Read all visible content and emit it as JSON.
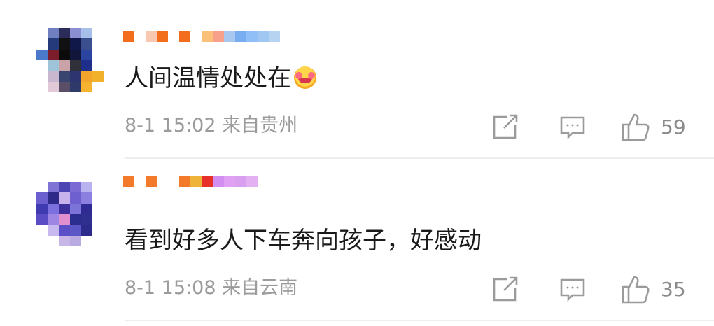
{
  "comments": [
    {
      "text": "人间温情处处在",
      "time": "8-1 15:02",
      "location": "来自贵州",
      "likes": "59",
      "avatar_colors": [
        "#ffffff",
        "#6f7fbf",
        "#2b2c5a",
        "#8b8fd1",
        "#a7c0ea",
        "#ffffff",
        "#ffffff",
        "#243a7a",
        "#111111",
        "#10184a",
        "#3b4f8f",
        "#ffffff",
        "#4b79ca",
        "#7b1d2a",
        "#0b0b0b",
        "#12163a",
        "#2a44a0",
        "#ffffff",
        "#ffffff",
        "#9fc4d9",
        "#c9a3a8",
        "#30303a",
        "#1d2f8a",
        "#ffffff",
        "#ffffff",
        "#c9b7cf",
        "#39456e",
        "#2d3470",
        "#f2a42b",
        "#f1b12a",
        "#ffffff",
        "#e2c9d8",
        "#5b4e68",
        "#303a6a",
        "#f7b32f",
        "#ffffff"
      ],
      "username_colors": [
        "#f26d1c",
        "#ffffff",
        "#f8c8b0",
        "#f26d1c",
        "#ffffff",
        "#f26d1c",
        "#ffffff",
        "#fbc07a",
        "#f7a08a",
        "#a8c8f0",
        "#78aef0",
        "#8fbff6",
        "#9fc7f2",
        "#b6d4f2"
      ]
    },
    {
      "text": "看到好多人下车奔向孩子，好感动",
      "time": "8-1 15:08",
      "location": "来自云南",
      "likes": "35",
      "avatar_colors": [
        "#ffffff",
        "#7f74d6",
        "#4c44b2",
        "#7b6ad4",
        "#b8b2ee",
        "#ffffff",
        "#6b5fd0",
        "#2d2a8a",
        "#c7b2ec",
        "#6f60cf",
        "#8b7fe0",
        "#ffffff",
        "#3f3ab0",
        "#7b70de",
        "#3c2f9b",
        "#7c74d8",
        "#2f2b92",
        "#ffffff",
        "#5a4cc4",
        "#9d86e4",
        "#e090cf",
        "#2b2d8f",
        "#2f2f8f",
        "#ffffff",
        "#ffffff",
        "#c8b8f0",
        "#5a4fc6",
        "#5b57c6",
        "#2c2a8a",
        "#ffffff",
        "#ffffff",
        "#ffffff",
        "#c8b6e8",
        "#b9aae2",
        "#ffffff",
        "#ffffff"
      ],
      "username_colors": [
        "#f47a2b",
        "#ffffff",
        "#f47a2b",
        "#ffffff",
        "#ffffff",
        "#f47a2b",
        "#f0b33a",
        "#e8302a",
        "#d28ef0",
        "#e0a0f4",
        "#d8a0ee",
        "#e3b0f2"
      ]
    }
  ],
  "icons": {
    "share": "share-icon",
    "reply": "comment-icon",
    "like": "thumbs-up-icon"
  }
}
